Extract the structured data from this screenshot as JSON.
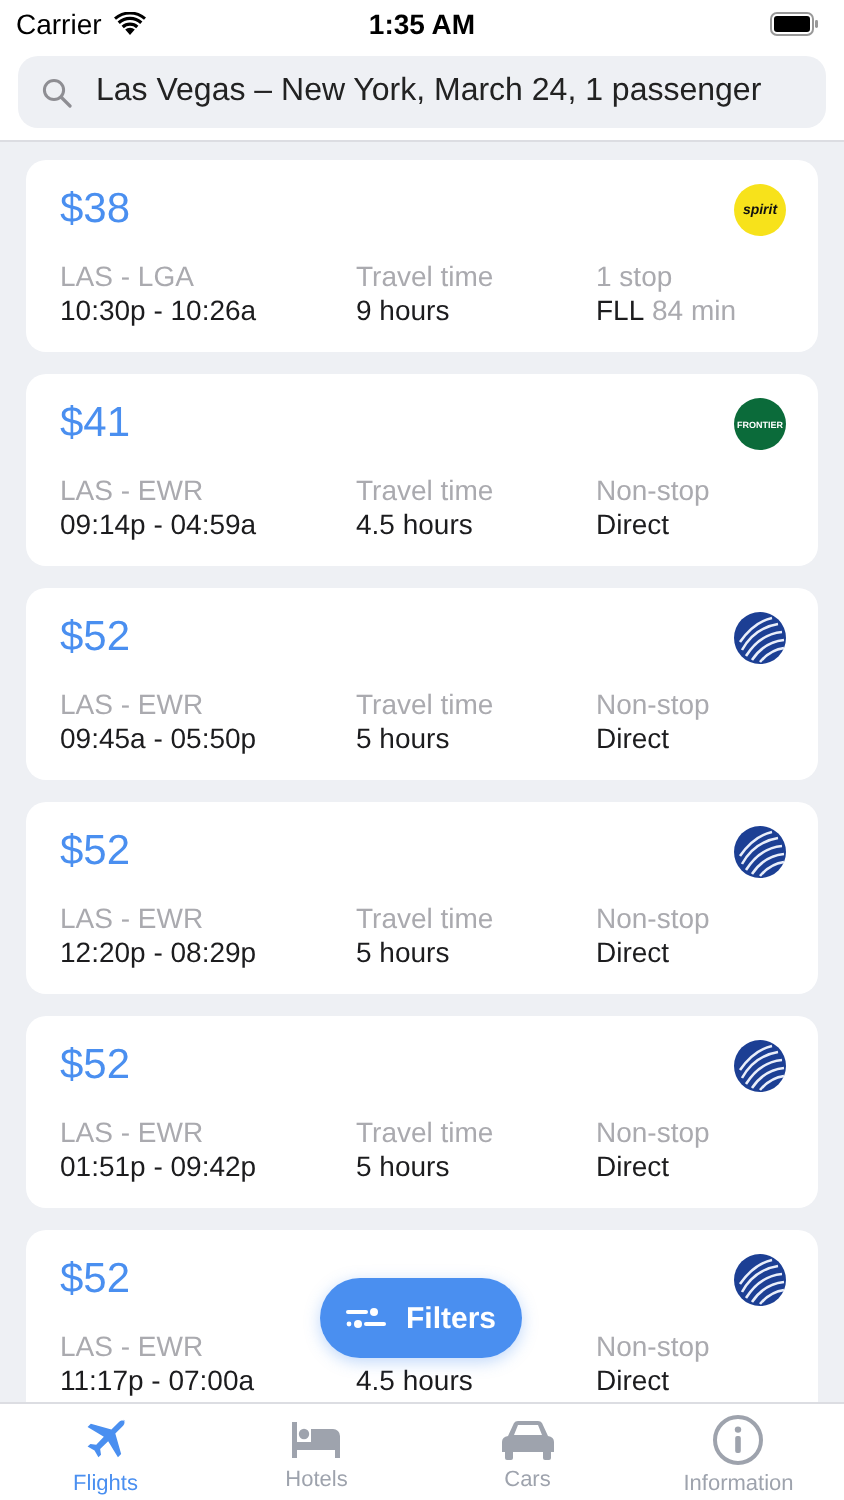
{
  "status_bar": {
    "carrier": "Carrier",
    "time": "1:35 AM"
  },
  "search": {
    "value": "Las Vegas – New York, March 24, 1 passenger"
  },
  "flights": [
    {
      "price": "$38",
      "logo": {
        "kind": "badge",
        "text": "spirit",
        "color": "#f7e21b"
      },
      "route": "LAS - LGA",
      "times": "10:30p - 10:26a",
      "travel_label": "Travel time",
      "travel": "9 hours",
      "stops_label": "1 stop",
      "stops": "FLL",
      "stop_extra": "84 min"
    },
    {
      "price": "$41",
      "logo": {
        "kind": "badge",
        "text": "FRONTIER",
        "color": "#0b6b3a"
      },
      "route": "LAS - EWR",
      "times": "09:14p - 04:59a",
      "travel_label": "Travel time",
      "travel": "4.5 hours",
      "stops_label": "Non-stop",
      "stops": "Direct"
    },
    {
      "price": "$52",
      "logo": {
        "kind": "globe"
      },
      "route": "LAS - EWR",
      "times": "09:45a - 05:50p",
      "travel_label": "Travel time",
      "travel": "5 hours",
      "stops_label": "Non-stop",
      "stops": "Direct"
    },
    {
      "price": "$52",
      "logo": {
        "kind": "globe"
      },
      "route": "LAS - EWR",
      "times": "12:20p - 08:29p",
      "travel_label": "Travel time",
      "travel": "5 hours",
      "stops_label": "Non-stop",
      "stops": "Direct"
    },
    {
      "price": "$52",
      "logo": {
        "kind": "globe"
      },
      "route": "LAS - EWR",
      "times": "01:51p - 09:42p",
      "travel_label": "Travel time",
      "travel": "5 hours",
      "stops_label": "Non-stop",
      "stops": "Direct"
    },
    {
      "price": "$52",
      "logo": {
        "kind": "globe"
      },
      "route": "LAS - EWR",
      "times": "11:17p - 07:00a",
      "travel": "4.5 hours",
      "stops_label": "Non-stop",
      "stops": "Direct"
    }
  ],
  "filters_button": {
    "label": "Filters"
  },
  "tabs": [
    {
      "kind": "plane",
      "label": "Flights",
      "selected": true
    },
    {
      "kind": "bed",
      "label": "Hotels",
      "selected": false
    },
    {
      "kind": "car",
      "label": "Cars",
      "selected": false
    },
    {
      "kind": "info",
      "label": "Information",
      "selected": false
    }
  ]
}
